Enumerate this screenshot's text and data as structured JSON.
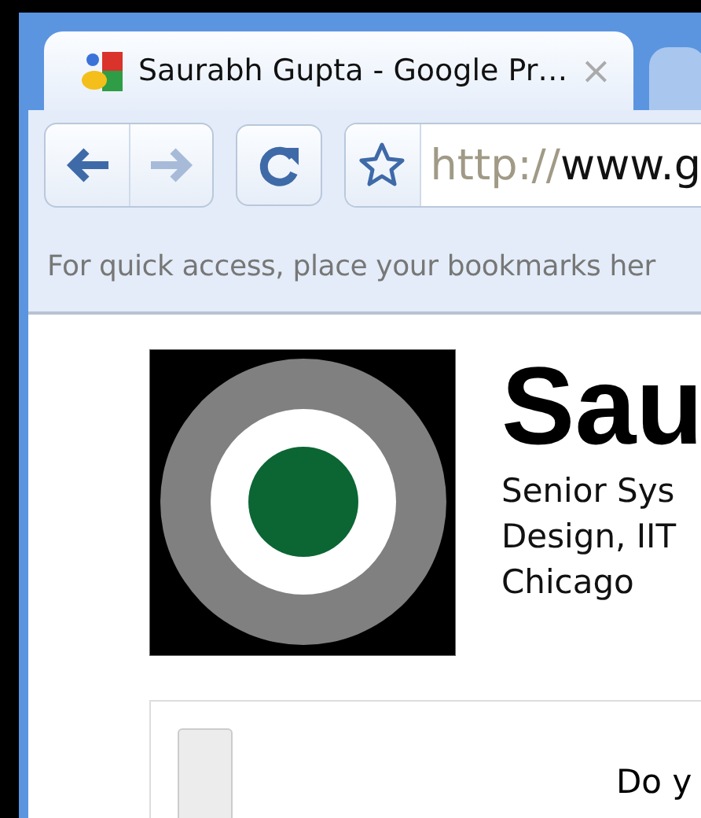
{
  "tabs": [
    {
      "title": "Saurabh Gupta - Google Pr…",
      "selected": true,
      "close": "×"
    },
    {
      "selected": false
    }
  ],
  "toolbar": {
    "back_enabled": true,
    "forward_enabled": false,
    "url_scheme": "http://",
    "url_rest": "www.g"
  },
  "bookmarks_bar": {
    "hint": "For quick access, place your bookmarks her"
  },
  "profile": {
    "name": "Sau",
    "tagline": [
      "Senior Sys",
      "Design, IIT",
      "Chicago"
    ]
  },
  "panel": {
    "text": "Do y"
  }
}
